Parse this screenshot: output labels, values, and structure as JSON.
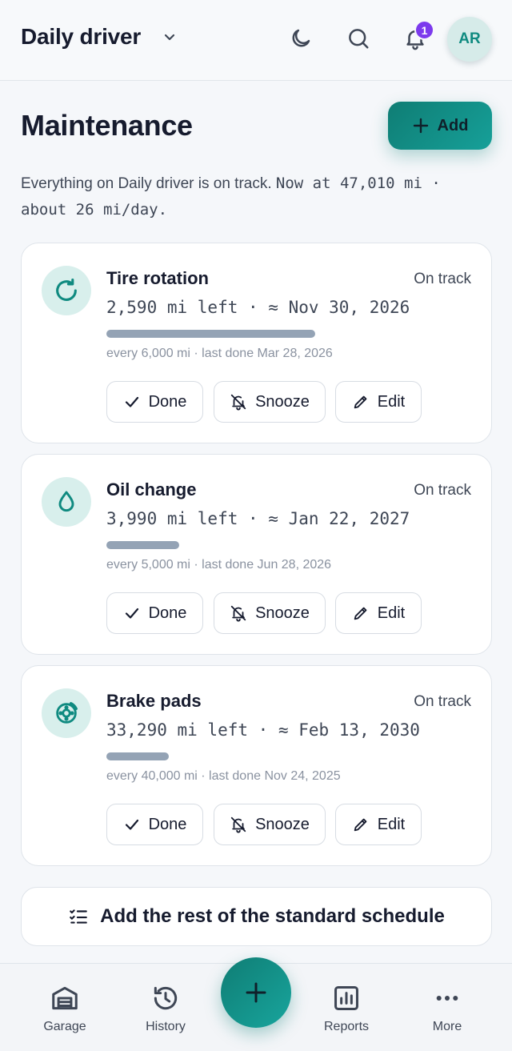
{
  "header": {
    "vehicle_name": "Daily driver",
    "notification_count": "1",
    "avatar_initials": "AR"
  },
  "page": {
    "title": "Maintenance",
    "add_label": "Add",
    "summary_text": "Everything on Daily driver is on track.",
    "summary_mileage": "Now at 47,010 mi · about 26 mi/day."
  },
  "items": [
    {
      "name": "Tire rotation",
      "status": "On track",
      "remaining": "2,590 mi left · ≈ Nov 30, 2026",
      "interval": "every 6,000 mi · last done Mar 28, 2026",
      "progress_fraction": 1.0,
      "icon": "rotate-icon"
    },
    {
      "name": "Oil change",
      "status": "On track",
      "remaining": "3,990 mi left · ≈ Jan 22, 2027",
      "interval": "every 5,000 mi · last done Jun 28, 2026",
      "progress_fraction": 0.35,
      "icon": "droplet-icon"
    },
    {
      "name": "Brake pads",
      "status": "On track",
      "remaining": "33,290 mi left · ≈ Feb 13, 2030",
      "interval": "every 40,000 mi · last done Nov 24, 2025",
      "progress_fraction": 0.3,
      "icon": "brake-disc-icon"
    }
  ],
  "actions": {
    "done": "Done",
    "snooze": "Snooze",
    "edit": "Edit"
  },
  "schedule_button": "Add the rest of the standard schedule",
  "nav": {
    "garage": "Garage",
    "history": "History",
    "reports": "Reports",
    "more": "More"
  },
  "colors": {
    "accent": "#0f8a80",
    "badge": "#7c3aed",
    "progress": "#94a3b5"
  }
}
